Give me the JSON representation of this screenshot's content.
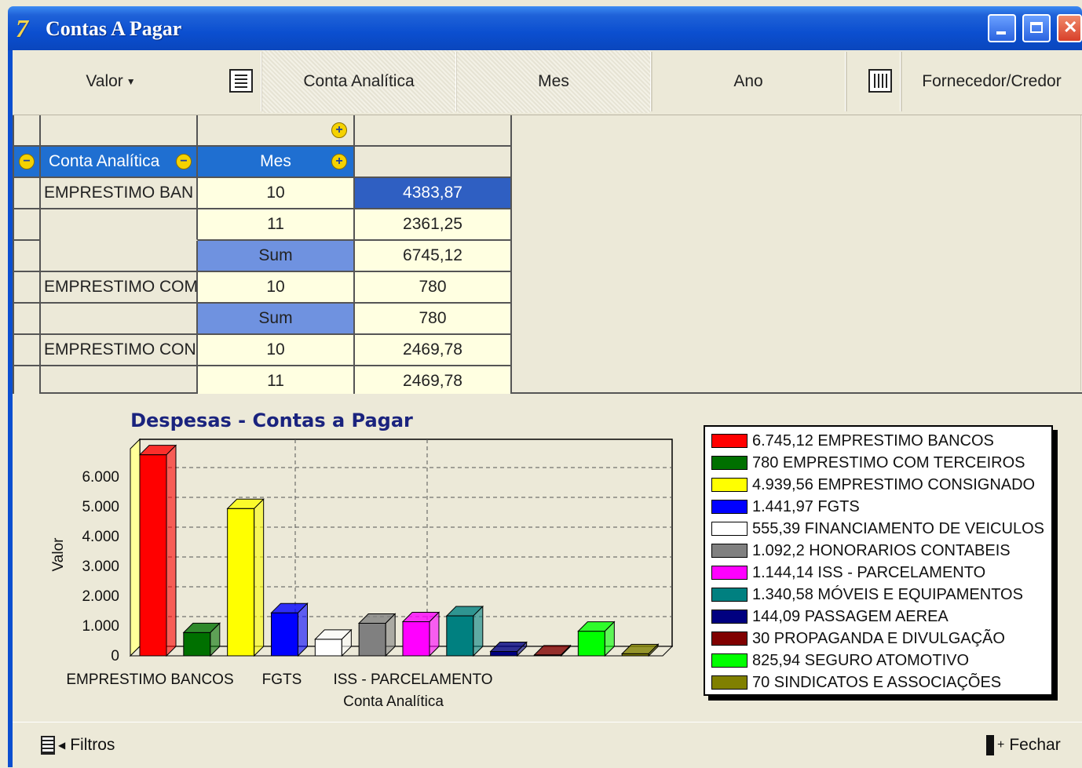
{
  "window": {
    "title": "Contas A Pagar",
    "app_icon": "7-logo-icon"
  },
  "toolbar": {
    "valor_label": "Valor",
    "items": [
      "Conta Analítica",
      "Mes",
      "Ano",
      "Fornecedor/Credor"
    ]
  },
  "pivot": {
    "col_headers": {
      "conta": "Conta Analítica",
      "mes": "Mes"
    },
    "rows": [
      {
        "conta": "EMPRESTIMO BAN",
        "mes": "10",
        "valor": "4383,87"
      },
      {
        "conta": "",
        "mes": "11",
        "valor": "2361,25"
      },
      {
        "conta": "",
        "mes": "Sum",
        "valor": "6745,12"
      },
      {
        "conta": "EMPRESTIMO COM",
        "mes": "10",
        "valor": "780"
      },
      {
        "conta": "",
        "mes": "Sum",
        "valor": "780"
      },
      {
        "conta": "EMPRESTIMO CON",
        "mes": "10",
        "valor": "2469,78"
      },
      {
        "conta": "",
        "mes": "11",
        "valor": "2469,78"
      }
    ]
  },
  "chart_data": {
    "type": "bar",
    "title": "Despesas - Contas a Pagar",
    "xlabel": "Conta Analítica",
    "ylabel": "Valor",
    "ylim": [
      0,
      7000
    ],
    "yticks": [
      "0",
      "1.000",
      "2.000",
      "3.000",
      "4.000",
      "5.000",
      "6.000"
    ],
    "x_tick_labels": [
      "EMPRESTIMO BANCOS",
      "FGTS",
      "ISS - PARCELAMENTO"
    ],
    "categories": [
      "EMPRESTIMO BANCOS",
      "EMPRESTIMO COM TERCEIROS",
      "EMPRESTIMO CONSIGNADO",
      "FGTS",
      "FINANCIAMENTO DE VEICULOS",
      "HONORARIOS CONTABEIS",
      "ISS - PARCELAMENTO",
      "MÓVEIS E EQUIPAMENTOS",
      "PASSAGEM AEREA",
      "PROPAGANDA E DIVULGAÇÃO",
      "SEGURO ATOMOTIVO",
      "SINDICATOS E ASSOCIAÇÕES"
    ],
    "values": [
      6745.12,
      780,
      4939.56,
      1441.97,
      555.39,
      1092.2,
      1144.14,
      1340.58,
      144.09,
      30,
      825.94,
      70
    ],
    "colors": [
      "#ff0000",
      "#007000",
      "#ffff00",
      "#0000ff",
      "#ffffff",
      "#808080",
      "#ff00ff",
      "#008080",
      "#000080",
      "#800000",
      "#00ff00",
      "#808000"
    ],
    "legend": [
      "6.745,12 EMPRESTIMO BANCOS",
      "780 EMPRESTIMO COM TERCEIROS",
      "4.939,56 EMPRESTIMO CONSIGNADO",
      "1.441,97 FGTS",
      "555,39 FINANCIAMENTO DE VEICULOS",
      "1.092,2 HONORARIOS CONTABEIS",
      "1.144,14 ISS - PARCELAMENTO",
      "1.340,58 MÓVEIS E EQUIPAMENTOS",
      "144,09 PASSAGEM AEREA",
      "30 PROPAGANDA E DIVULGAÇÃO",
      "825,94 SEGURO ATOMOTIVO",
      "70 SINDICATOS E ASSOCIAÇÕES"
    ],
    "legend_position": "right",
    "grid": true
  },
  "footer": {
    "filtros": "Filtros",
    "fechar": "Fechar"
  }
}
